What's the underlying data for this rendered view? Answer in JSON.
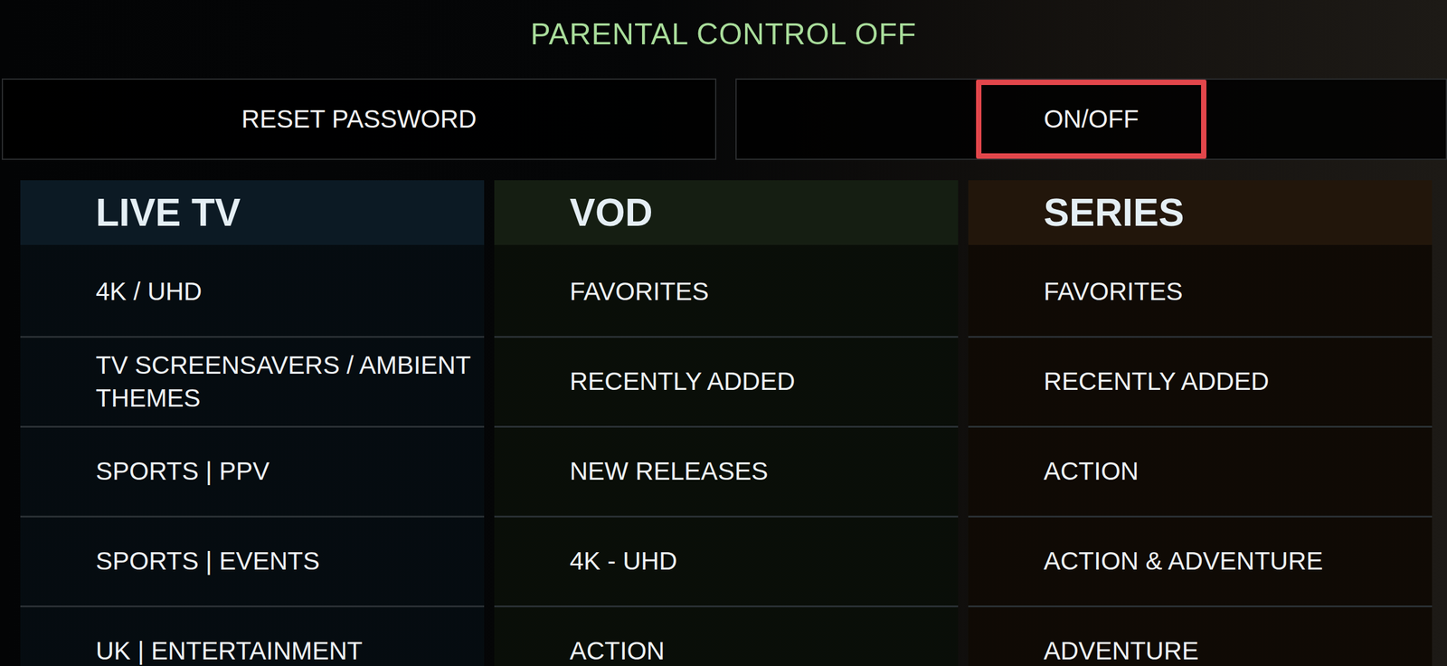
{
  "header": {
    "title": "PARENTAL CONTROL OFF"
  },
  "buttons": [
    {
      "label": "RESET PASSWORD",
      "selected": false
    },
    {
      "label": "ON/OFF",
      "selected": true
    }
  ],
  "columns": [
    {
      "title": "LIVE TV",
      "color": "#0c1a24",
      "items": [
        "4K / UHD",
        "TV SCREENSAVERS / AMBIENT THEMES",
        "SPORTS | PPV",
        "SPORTS | EVENTS",
        "UK | ENTERTAINMENT"
      ]
    },
    {
      "title": "VOD",
      "color": "#151e12",
      "items": [
        "FAVORITES",
        "RECENTLY ADDED",
        "NEW RELEASES",
        "4K - UHD",
        "ACTION"
      ]
    },
    {
      "title": "SERIES",
      "color": "#22160b",
      "items": [
        "FAVORITES",
        "RECENTLY ADDED",
        "ACTION",
        "ACTION & ADVENTURE",
        "ADVENTURE"
      ]
    }
  ]
}
